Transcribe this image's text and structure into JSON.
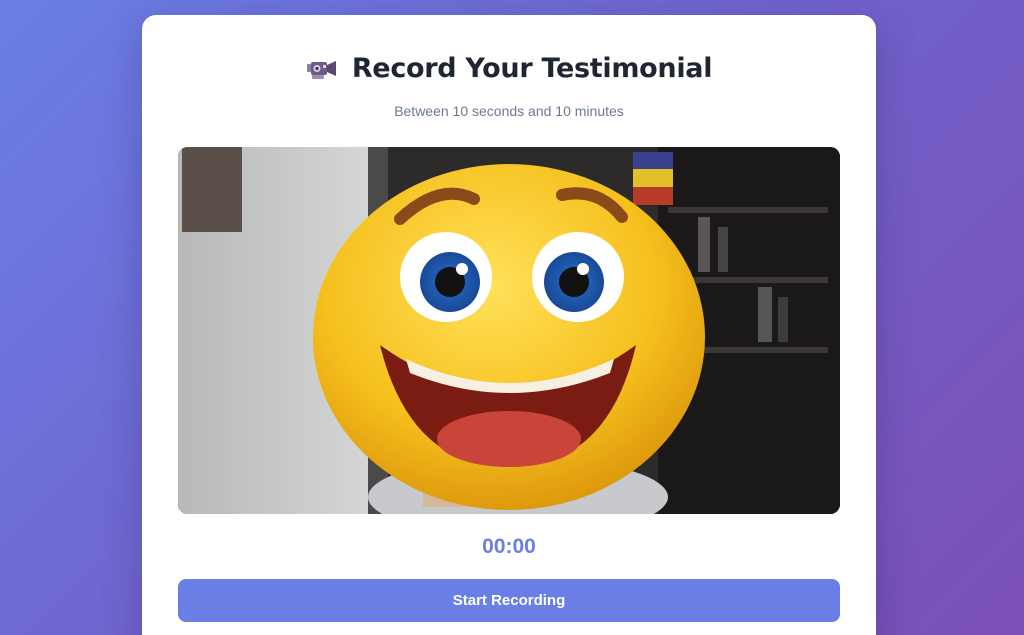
{
  "header": {
    "icon": "video-camera-icon",
    "title": "Record Your Testimonial",
    "subtitle": "Between 10 seconds and 10 minutes"
  },
  "preview": {
    "content": "webcam-preview-emoji-face"
  },
  "recorder": {
    "timer": "00:00",
    "start_label": "Start Recording"
  },
  "colors": {
    "accent": "#6a7fe6",
    "timer": "#6a7fe0",
    "title": "#1e2533",
    "subtitle": "#6b7a90"
  }
}
